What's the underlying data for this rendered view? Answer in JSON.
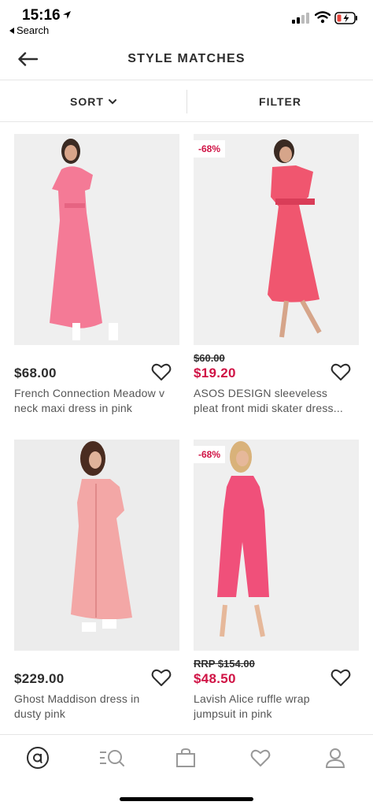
{
  "status_bar": {
    "time": "15:16",
    "back_app": "Search"
  },
  "header": {
    "title": "STYLE MATCHES"
  },
  "toolbar": {
    "sort_label": "SORT",
    "filter_label": "FILTER"
  },
  "colors": {
    "sale": "#d01345",
    "text": "#2d2d2d",
    "dress_pink": "#f47a96"
  },
  "products": [
    {
      "price": "$68.00",
      "old_price": "",
      "badge": "",
      "title_line1": "French Connection Meadow v",
      "title_line2": "neck maxi dress in pink"
    },
    {
      "price": "$19.20",
      "old_price": "$60.00",
      "badge": "-68%",
      "title_line1": "ASOS DESIGN sleeveless",
      "title_line2": "pleat front midi skater dress..."
    },
    {
      "price": "$229.00",
      "old_price": "",
      "badge": "",
      "title_line1": "Ghost Maddison dress in",
      "title_line2": "dusty pink"
    },
    {
      "price": "$48.50",
      "old_price": "RRP $154.00",
      "badge": "-68%",
      "title_line1": "Lavish Alice ruffle wrap",
      "title_line2": "jumpsuit in pink"
    }
  ],
  "bottom_nav": [
    "home-icon",
    "search-list-icon",
    "bag-icon",
    "saved-heart-icon",
    "account-icon"
  ]
}
